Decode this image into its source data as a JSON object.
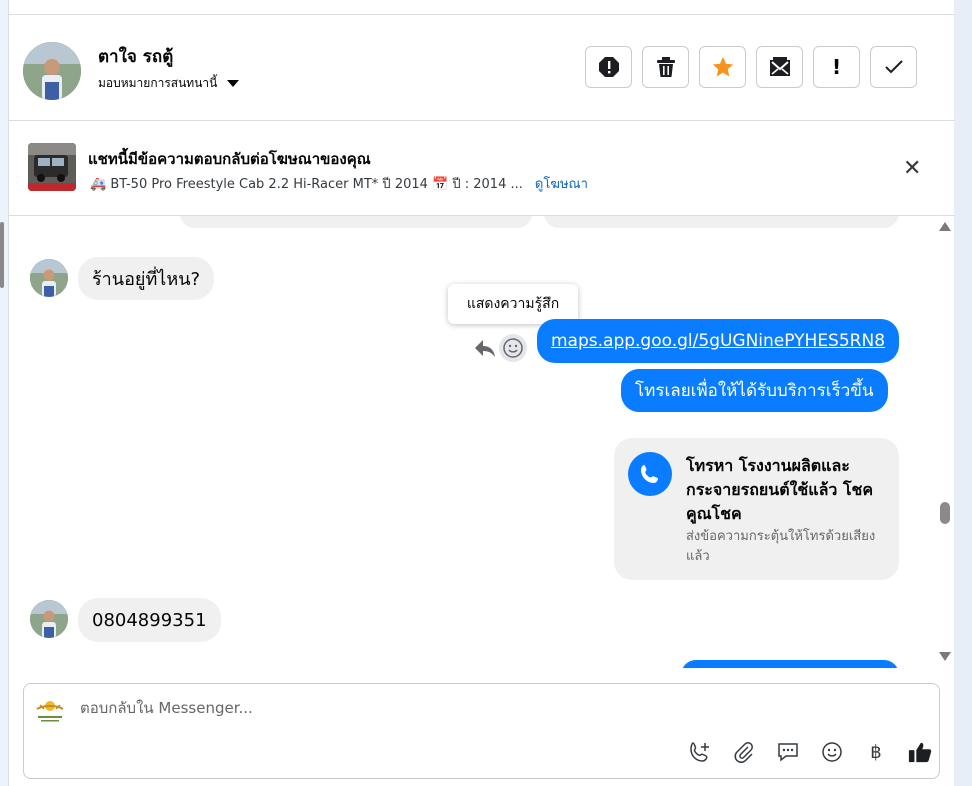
{
  "header": {
    "contact_name": "ตาใจ รถตู้",
    "assign_label": "มอบหมายการสนทนานี้",
    "actions": [
      {
        "name": "alert-icon"
      },
      {
        "name": "trash-icon"
      },
      {
        "name": "star-icon"
      },
      {
        "name": "mark-unread-icon"
      },
      {
        "name": "spam-icon"
      },
      {
        "name": "check-icon"
      }
    ]
  },
  "ad_banner": {
    "title": "แชทนี้มีข้อความตอบกลับต่อโฆษณาของคุณ",
    "subtitle": "🚑 BT-50 Pro Freestyle Cab 2.2 Hi-Racer MT* ปี 2014 📅 ปี : 2014 ...",
    "link": "ดูโฆษณา",
    "close": "✕"
  },
  "messages": {
    "incoming_1": "ร้านอยู่ที่ไหน?",
    "tooltip": "แสดงความรู้สึก",
    "outgoing_link": "maps.app.goo.gl/5gUGNinePYHES5RN8",
    "outgoing_2": "โทรเลยเพื่อให้ได้รับบริการเร็วขึ้น",
    "call_card": {
      "title": "โทรหา โรงงานผลิตและกระจายรถยนต์ใช้แล้ว โชคคูณโชค",
      "subtitle": "ส่งข้อความกระตุ้นให้โทรด้วยเสียงแล้ว"
    },
    "incoming_2": "0804899351"
  },
  "composer": {
    "placeholder": "ตอบกลับใน Messenger...",
    "tools": [
      "add-call-icon",
      "attachment-icon",
      "saved-reply-icon",
      "emoji-icon",
      "baht-payment-icon",
      "like-icon"
    ],
    "baht_symbol": "฿"
  },
  "colors": {
    "accent": "#0a7cff",
    "bubble_in": "#f0f0f0",
    "link": "#0a66c2",
    "star": "#f7931e"
  }
}
